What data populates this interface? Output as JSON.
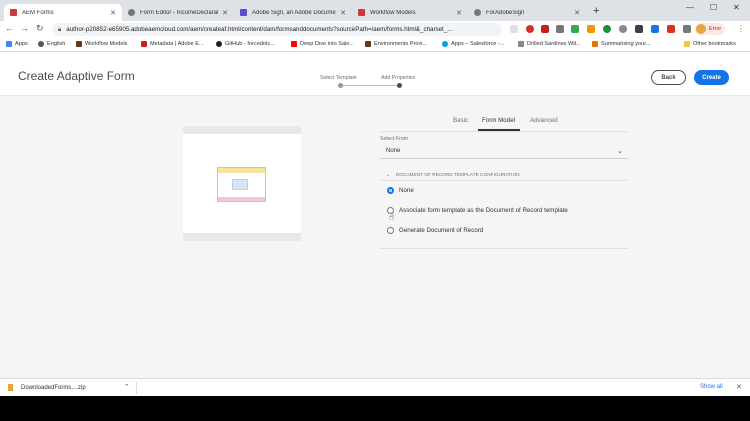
{
  "browser": {
    "tabs": [
      {
        "label": "AEM Forms",
        "icon": "document-icon",
        "active": true
      },
      {
        "label": "Form Editor - IncomeDeclaration",
        "icon": "globe-icon",
        "active": false
      },
      {
        "label": "Adobe Sign, an Adobe Documen...",
        "icon": "adobe-sign-icon",
        "active": false
      },
      {
        "label": "Workflow Models",
        "icon": "document-icon",
        "active": false
      },
      {
        "label": "ForAdobeSign",
        "icon": "globe-icon",
        "active": false
      }
    ],
    "new_tab_label": "+",
    "address": "author-p20852-e65905.adobeaemcloud.com/aem/createaf.html/content/dam/formsanddocuments?sourcePath=/aem/forms.html&_charset_...",
    "profile_label": "Error",
    "bookmarks": [
      "Apps",
      "English",
      "Workflow Models",
      "Metadata | Adobe E...",
      "GitHub - forcedotc...",
      "Deep Dive into Sale...",
      "Environments Provi...",
      "Apps – Salesforce -...",
      "Drilled Sardines Wit...",
      "Summarising your...",
      "Other bookmarks"
    ]
  },
  "header": {
    "title": "Create Adaptive Form",
    "steps": [
      "Select Template",
      "Add Properties"
    ],
    "back_label": "Back",
    "create_label": "Create"
  },
  "properties": {
    "tabs": [
      "Basic",
      "Form Model",
      "Advanced"
    ],
    "active_tab": "Form Model",
    "select_from_label": "Select From",
    "select_from_value": "None",
    "section_title": "DOCUMENT OF RECORD TEMPLATE CONFIGURATION",
    "options": [
      {
        "label": "None",
        "selected": true
      },
      {
        "label": "Associate form template as the Document of Record template",
        "selected": false
      },
      {
        "label": "Generate Document of Record",
        "selected": false
      }
    ]
  },
  "download_bar": {
    "file_name": "DownloadedForms....zip",
    "show_all_label": "Show all"
  },
  "colors": {
    "accent": "#1473e6",
    "tab_strip": "#dee1e6"
  }
}
